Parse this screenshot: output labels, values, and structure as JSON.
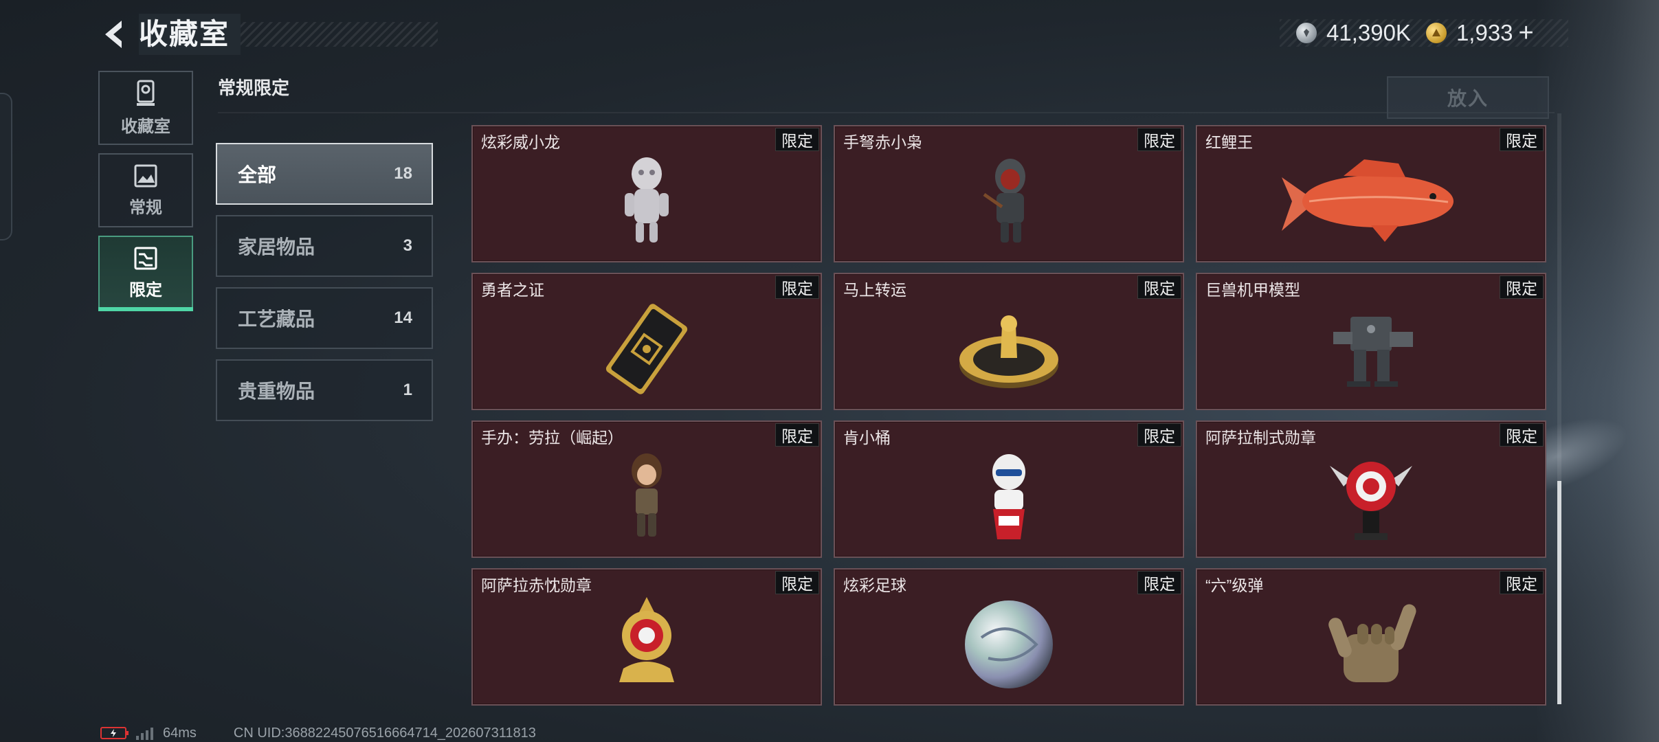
{
  "header": {
    "title": "收藏室",
    "back_icon": "chevron-left-icon"
  },
  "currency": [
    {
      "icon": "silver-coin-icon",
      "value": "41,390K"
    },
    {
      "icon": "gold-coin-icon",
      "value": "1,933",
      "plus": "+"
    }
  ],
  "left_nav": [
    {
      "label": "收藏室",
      "icon": "trophy-icon",
      "active": false
    },
    {
      "label": "常规",
      "icon": "picture-icon",
      "active": false
    },
    {
      "label": "限定",
      "icon": "limited-icon",
      "active": true
    }
  ],
  "section_title": "常规限定",
  "put_button": "放入",
  "categories": [
    {
      "label": "全部",
      "count": "18",
      "active": true
    },
    {
      "label": "家居物品",
      "count": "3",
      "active": false
    },
    {
      "label": "工艺藏品",
      "count": "14",
      "active": false
    },
    {
      "label": "贵重物品",
      "count": "1",
      "active": false
    }
  ],
  "items": [
    {
      "name": "炫彩威小龙",
      "badge": "限定",
      "icon": "dragon-figure-icon"
    },
    {
      "name": "手弩赤小枭",
      "badge": "限定",
      "icon": "hooded-figure-icon"
    },
    {
      "name": "红鲤王",
      "badge": "限定",
      "icon": "red-carp-icon"
    },
    {
      "name": "勇者之证",
      "badge": "限定",
      "icon": "gold-card-icon"
    },
    {
      "name": "马上转运",
      "badge": "限定",
      "icon": "golden-spinner-icon"
    },
    {
      "name": "巨兽机甲模型",
      "badge": "限定",
      "icon": "mech-model-icon"
    },
    {
      "name": "手办：劳拉（崛起）",
      "badge": "限定",
      "icon": "lara-figure-icon"
    },
    {
      "name": "肯小桶",
      "badge": "限定",
      "icon": "kfc-figure-icon"
    },
    {
      "name": "阿萨拉制式勋章",
      "badge": "限定",
      "icon": "red-medal-icon"
    },
    {
      "name": "阿萨拉赤忱勋章",
      "badge": "限定",
      "icon": "gold-medal-icon"
    },
    {
      "name": "炫彩足球",
      "badge": "限定",
      "icon": "iridescent-ball-icon"
    },
    {
      "name": "“六”级弹",
      "badge": "限定",
      "icon": "hand-gesture-icon"
    }
  ],
  "footer": {
    "ping": "64ms",
    "uid": "CN UID:36882245076516664714_202607311813",
    "battery_icon": "battery-low-icon",
    "signal_icon": "signal-bars-icon"
  },
  "colors": {
    "accent": "#4fd6a6",
    "card_bg": "#3b1e24",
    "badge_bg": "#101215"
  }
}
